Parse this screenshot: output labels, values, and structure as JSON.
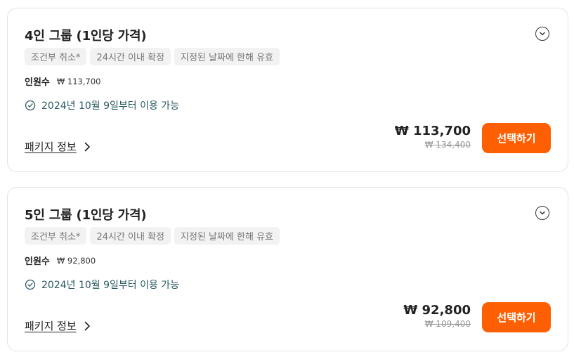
{
  "packages": [
    {
      "title": "4인 그룹 (1인당 가격)",
      "tags": [
        "조건부 취소*",
        "24시간 이내 확정",
        "지정된 날짜에 한해 유효"
      ],
      "pax_label": "인원수",
      "pax_price": "₩ 113,700",
      "availability": "2024년 10월 9일부터 이용 가능",
      "info_link": "패키지 정보",
      "price": "₩ 113,700",
      "original_price": "₩ 134,400",
      "select_label": "선택하기"
    },
    {
      "title": "5인 그룹 (1인당 가격)",
      "tags": [
        "조건부 취소*",
        "24시간 이내 확정",
        "지정된 날짜에 한해 유효"
      ],
      "pax_label": "인원수",
      "pax_price": "₩ 92,800",
      "availability": "2024년 10월 9일부터 이용 가능",
      "info_link": "패키지 정보",
      "price": "₩ 92,800",
      "original_price": "₩ 109,400",
      "select_label": "선택하기"
    }
  ],
  "icons": {
    "expand": "chevron-down-circle-icon",
    "availability": "check-circle-icon",
    "info_link": "chevron-right-icon"
  },
  "colors": {
    "accent": "#ff5f03",
    "availability_text": "#2a5a63",
    "tag_bg": "#f2f2f2"
  }
}
